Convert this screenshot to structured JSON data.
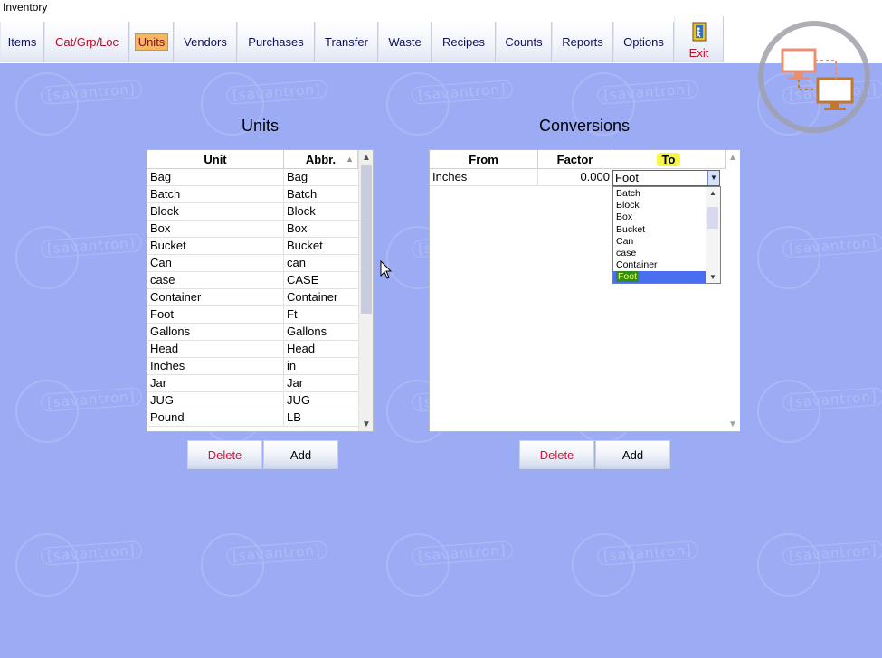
{
  "window": {
    "title": "Inventory"
  },
  "menu": {
    "items": [
      {
        "label": "Items"
      },
      {
        "label": "Cat/Grp/Loc"
      },
      {
        "label": "Units"
      },
      {
        "label": "Vendors"
      },
      {
        "label": "Purchases"
      },
      {
        "label": "Transfer"
      },
      {
        "label": "Waste"
      },
      {
        "label": "Recipes"
      },
      {
        "label": "Counts"
      },
      {
        "label": "Reports"
      },
      {
        "label": "Options"
      }
    ],
    "exit": {
      "label": "Exit",
      "icon": "exit-door-icon"
    },
    "active_item": "Units"
  },
  "watermark": {
    "text": "[savantron]"
  },
  "units": {
    "heading": "Units",
    "columns": [
      "Unit",
      "Abbr."
    ],
    "rows": [
      [
        "Bag",
        "Bag"
      ],
      [
        "Batch",
        "Batch"
      ],
      [
        "Block",
        "Block"
      ],
      [
        "Box",
        "Box"
      ],
      [
        "Bucket",
        "Bucket"
      ],
      [
        "Can",
        "can"
      ],
      [
        "case",
        "CASE"
      ],
      [
        "Container",
        "Container"
      ],
      [
        "Foot",
        "Ft"
      ],
      [
        "Gallons",
        "Gallons"
      ],
      [
        "Head",
        "Head"
      ],
      [
        "Inches",
        "in"
      ],
      [
        "Jar",
        "Jar"
      ],
      [
        "JUG",
        "JUG"
      ],
      [
        "Pound",
        "LB"
      ]
    ],
    "delete_label": "Delete",
    "add_label": "Add"
  },
  "conversions": {
    "heading": "Conversions",
    "columns": [
      "From",
      "Factor",
      "To"
    ],
    "row": {
      "from": "Inches",
      "factor": "0.000",
      "to": "Foot"
    },
    "dropdown_options": [
      "Batch",
      "Block",
      "Box",
      "Bucket",
      "Can",
      "case",
      "Container",
      "Foot"
    ],
    "selected_option": "Foot",
    "delete_label": "Delete",
    "add_label": "Add"
  },
  "colors": {
    "background": "#9bacf5",
    "active_tab": "#f4b860",
    "delete_text": "#d8103a",
    "highlight": "#f6f645",
    "selection": "#4a6ef0"
  }
}
